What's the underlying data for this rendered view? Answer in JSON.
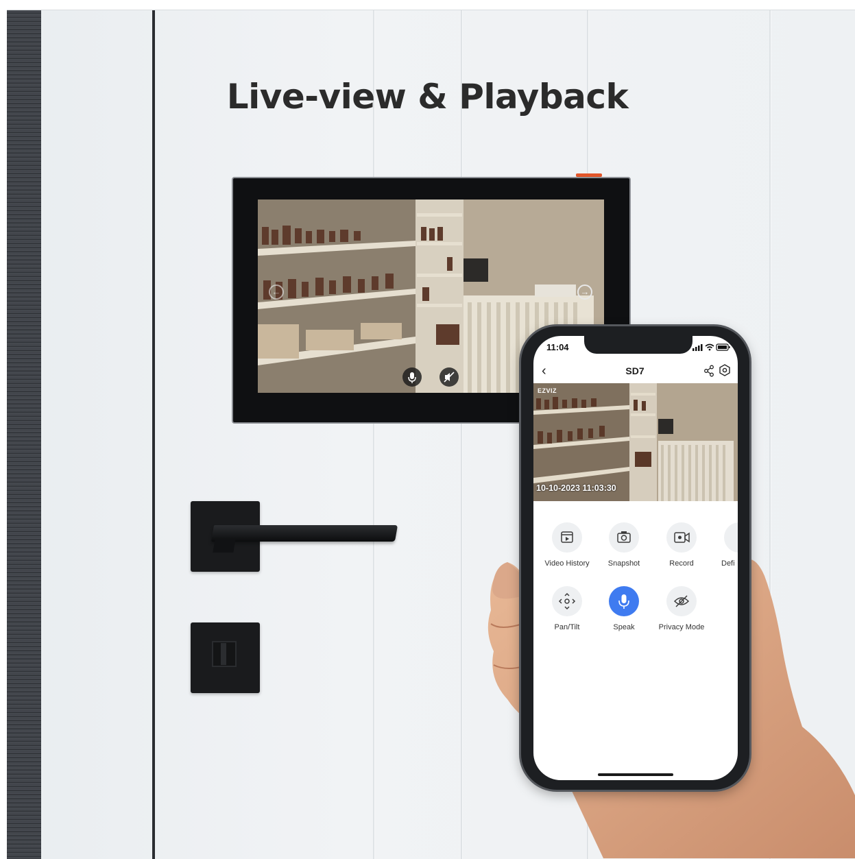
{
  "title": "Live-view & Playback",
  "tablet": {
    "nav_prev_icon": "arrow-left-icon",
    "nav_next_icon": "arrow-right-icon",
    "controls": [
      {
        "icon": "microphone-icon"
      },
      {
        "icon": "mute-icon"
      }
    ]
  },
  "phone": {
    "status_time": "11:04",
    "status_icons": "signal-wifi-battery",
    "device_name": "SD7",
    "video_brand": "EZVIZ",
    "video_timestamp": "10-10-2023 11:03:30",
    "features": [
      {
        "label": "Video History",
        "icon": "video-history-icon"
      },
      {
        "label": "Snapshot",
        "icon": "camera-icon"
      },
      {
        "label": "Record",
        "icon": "record-icon"
      },
      {
        "label": "Defi",
        "icon": "definition-icon"
      },
      {
        "label": "Pan/Tilt",
        "icon": "pan-tilt-icon"
      },
      {
        "label": "Speak",
        "icon": "microphone-icon",
        "active": true
      },
      {
        "label": "Privacy Mode",
        "icon": "privacy-eye-icon"
      }
    ]
  },
  "colors": {
    "accent": "#3f7bf0",
    "led": "#e2562a",
    "title": "#2b2b2b"
  }
}
